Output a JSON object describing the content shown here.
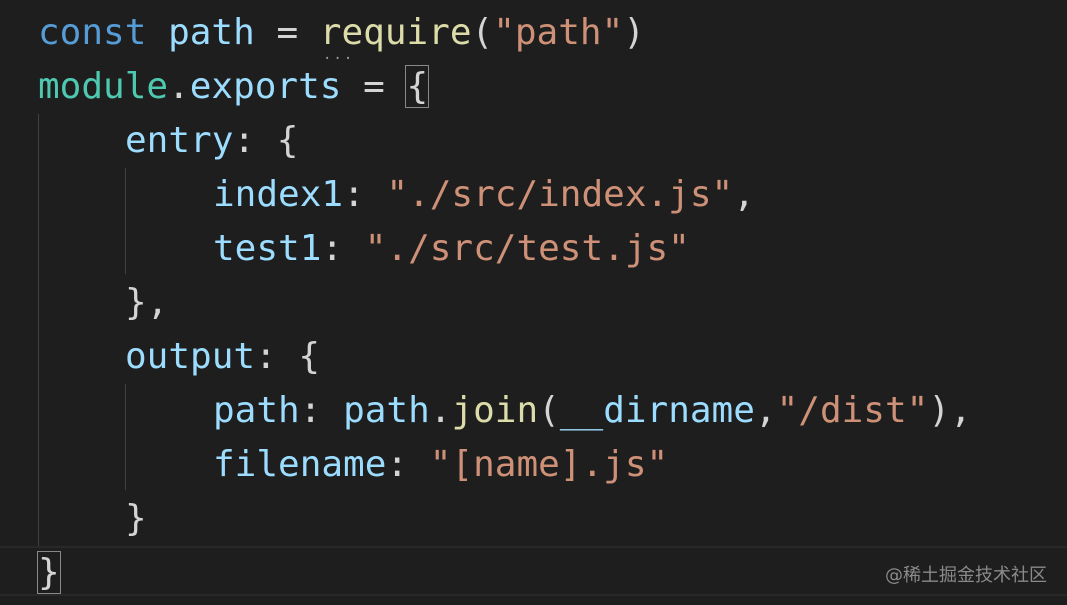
{
  "code": {
    "line1": {
      "kw": "const",
      "name": "path",
      "eq": " = ",
      "fn": "require",
      "open": "(",
      "str": "\"path\"",
      "close": ")"
    },
    "line2": {
      "obj": "module",
      "dot": ".",
      "prop": "exports",
      "eq": " = ",
      "brace": "{"
    },
    "line3": {
      "key": "entry",
      "colon": ": ",
      "brace": "{"
    },
    "line4": {
      "key": "index1",
      "colon": ": ",
      "str": "\"./src/index.js\"",
      "comma": ","
    },
    "line5": {
      "key": "test1",
      "colon": ": ",
      "str": "\"./src/test.js\""
    },
    "line6": {
      "text": "},"
    },
    "line7": {
      "key": "output",
      "colon": ": ",
      "brace": "{"
    },
    "line8": {
      "key": "path",
      "colon": ": ",
      "obj": "path",
      "dot": ".",
      "fn": "join",
      "open": "(",
      "arg": "__dirname",
      "comma": ",",
      "str": "\"/dist\"",
      "close": "),"
    },
    "line9": {
      "key": "filename",
      "colon": ": ",
      "str": "\"[name].js\""
    },
    "line10": {
      "text": "}"
    },
    "line11": {
      "text": "}"
    }
  },
  "watermark": "@稀土掘金技术社区",
  "colors": {
    "background": "#1e1e1e",
    "keyword": "#569cd6",
    "variable": "#9cdcfe",
    "function": "#dcdcaa",
    "string": "#ce9178",
    "object": "#4ec9b0"
  }
}
